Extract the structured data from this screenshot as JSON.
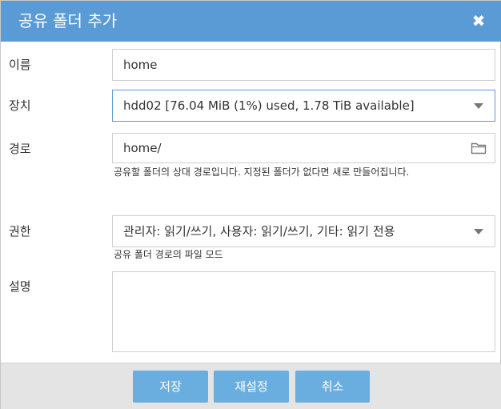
{
  "dialog": {
    "title": "공유 폴더 추가",
    "close_icon": "close-icon"
  },
  "fields": {
    "name": {
      "label": "이름",
      "value": "home"
    },
    "device": {
      "label": "장치",
      "value": "hdd02 [76.04 MiB (1%) used, 1.78 TiB available]"
    },
    "path": {
      "label": "경로",
      "value": "home/",
      "hint": "공유할 폴더의 상대 경로입니다. 지정된 폴더가 없다면 새로 만들어집니다.",
      "icon": "folder-icon"
    },
    "permissions": {
      "label": "권한",
      "value": "관리자: 읽기/쓰기, 사용자: 읽기/쓰기, 기타: 읽기 전용",
      "hint": "공유 폴더 경로의 파일 모드"
    },
    "description": {
      "label": "설명",
      "value": ""
    }
  },
  "buttons": {
    "save": "저장",
    "reset": "재설정",
    "cancel": "취소"
  },
  "colors": {
    "titlebar": "#5b9bd5",
    "button": "#6aaee0",
    "focus_border": "#5b9bd5"
  }
}
